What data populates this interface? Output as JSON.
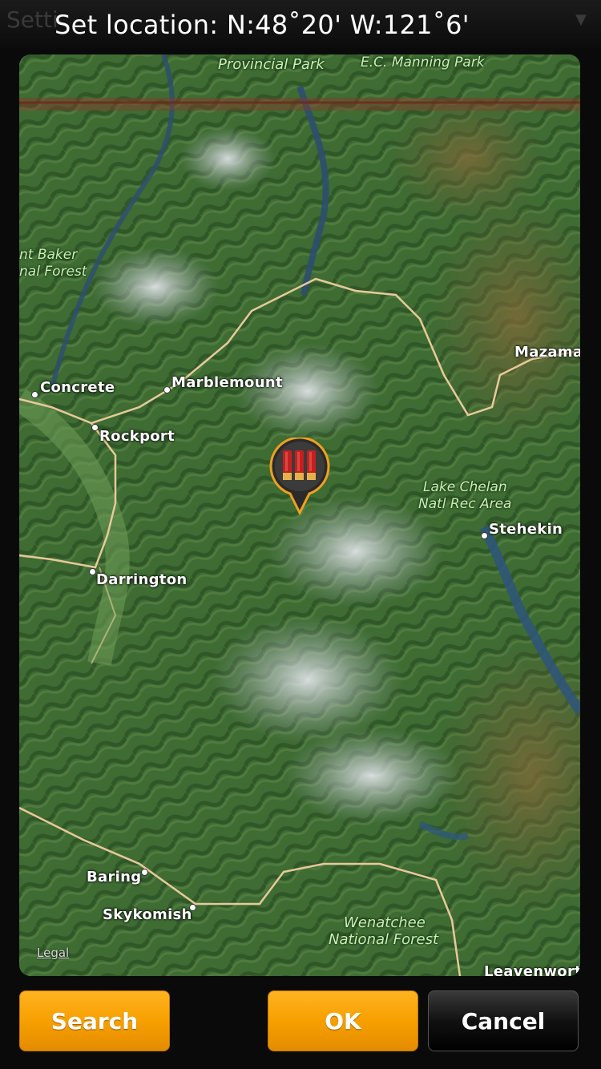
{
  "header": {
    "title": "Set location: N:48˚20' W:121˚6'",
    "behind_title": "Setti",
    "behind_right": "▼"
  },
  "map": {
    "legal_link": "Legal",
    "places": {
      "provincial_park": "Provincial Park",
      "manning_park": "E.C. Manning Park",
      "mt_baker_line1": "nt Baker",
      "mt_baker_line2": "nal Forest",
      "mazama": "Mazama",
      "concrete": "Concrete",
      "marblemount": "Marblemount",
      "rockport": "Rockport",
      "lake_chelan_line1": "Lake Chelan",
      "lake_chelan_line2": "Natl Rec Area",
      "stehekin": "Stehekin",
      "darrington": "Darrington",
      "baring": "Baring",
      "skykomish": "Skykomish",
      "wenatchee_line1": "Wenatchee",
      "wenatchee_line2": "National Forest",
      "leavenworth": "Leavenwort"
    },
    "marker": {
      "icon": "shotgun-shells-icon",
      "color": "#c0201f"
    }
  },
  "buttons": {
    "search": "Search",
    "ok": "OK",
    "cancel": "Cancel"
  },
  "colors": {
    "accent_orange": "#f7a000",
    "dark_button": "#111111",
    "map_border_line": "#e8c99a"
  }
}
